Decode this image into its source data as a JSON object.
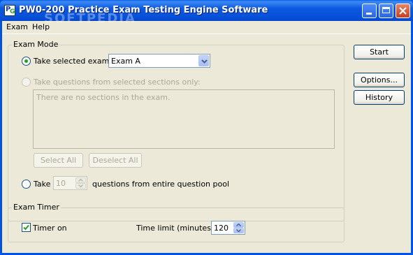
{
  "window": {
    "title": "PW0-200 Practice Exam Testing Engine Software",
    "watermark": "SOFTPEDIA"
  },
  "menu": {
    "items": [
      {
        "label": "Exam"
      },
      {
        "label": "Help"
      }
    ]
  },
  "exam_mode": {
    "legend": "Exam Mode",
    "take_selected_label": "Take selected exam:",
    "take_selected_checked": true,
    "exam_select_value": "Exam A",
    "take_sections_label": "Take questions from selected sections only:",
    "sections_placeholder": "There are no sections in the exam.",
    "select_all_label": "Select All",
    "deselect_all_label": "Deselect All",
    "take_count_label": "Take",
    "take_count_value": "10",
    "take_count_suffix": "questions from entire question pool"
  },
  "exam_timer": {
    "legend": "Exam Timer",
    "timer_on_label": "Timer on",
    "timer_on_checked": true,
    "time_limit_label": "Time limit (minutes):",
    "time_limit_value": "120"
  },
  "side_buttons": {
    "start_label": "Start",
    "options_label": "Options...",
    "history_label": "History"
  }
}
